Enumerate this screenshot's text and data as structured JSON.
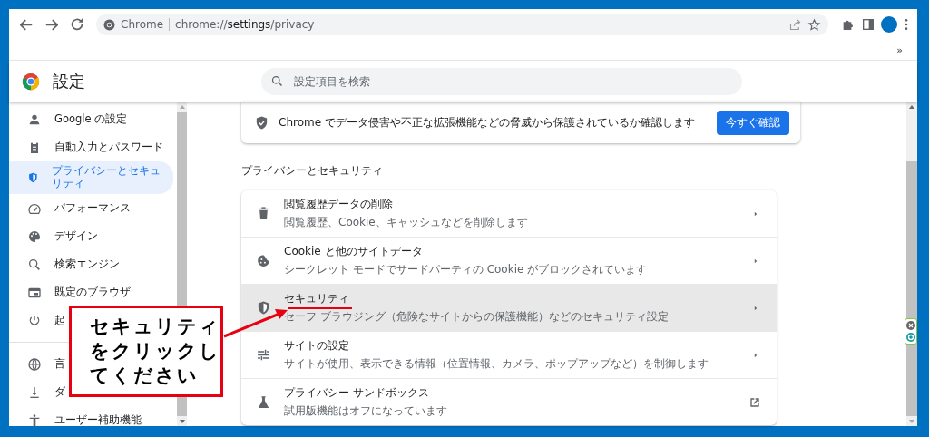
{
  "browser": {
    "site_label": "Chrome",
    "url": "chrome://**settings**/privacy",
    "overflow": "»"
  },
  "header": {
    "title": "設定",
    "search": {
      "placeholder": "設定項目を検索"
    }
  },
  "sidebar": {
    "items": [
      {
        "label": "Google の設定",
        "selected": false
      },
      {
        "label": "自動入力とパスワード",
        "selected": false
      },
      {
        "label": "プライバシーとセキュリティ",
        "selected": true
      },
      {
        "label": "パフォーマンス",
        "selected": false
      },
      {
        "label": "デザイン",
        "selected": false
      },
      {
        "label": "検索エンジン",
        "selected": false
      },
      {
        "label": "既定のブラウザ",
        "selected": false
      },
      {
        "label": "起",
        "selected": false
      }
    ],
    "more_items": [
      {
        "label": "言",
        "selected": false
      },
      {
        "label": "ダ",
        "selected": false
      },
      {
        "label": "ユーザー補助機能",
        "selected": false
      }
    ]
  },
  "safety_check": {
    "text": "Chrome でデータ侵害や不正な拡張機能などの脅威から保護されているか確認します",
    "button": "今すぐ確認"
  },
  "section_title": "プライバシーとセキュリティ",
  "rows": [
    {
      "kind": "subpage",
      "title": "閲覧履歴データの削除",
      "subtitle": "閲覧履歴、Cookie、キャッシュなどを削除します",
      "highlighted": false
    },
    {
      "kind": "subpage",
      "title": "Cookie と他のサイトデータ",
      "subtitle": "シークレット モードでサードパーティの Cookie がブロックされています",
      "highlighted": false
    },
    {
      "kind": "subpage",
      "title": "セキュリティ",
      "subtitle": "セーフ ブラウジング（危険なサイトからの保護機能）などのセキュリティ設定",
      "highlighted": true
    },
    {
      "kind": "subpage",
      "title": "サイトの設定",
      "subtitle": "サイトが使用、表示できる情報（位置情報、カメラ、ポップアップなど）を制御します",
      "highlighted": false
    },
    {
      "kind": "external",
      "title": "プライバシー サンドボックス",
      "subtitle": "試用版機能はオフになっています",
      "highlighted": false
    }
  ],
  "callout": {
    "lines": [
      "セキュリティ",
      "をクリックし",
      "てください"
    ]
  }
}
